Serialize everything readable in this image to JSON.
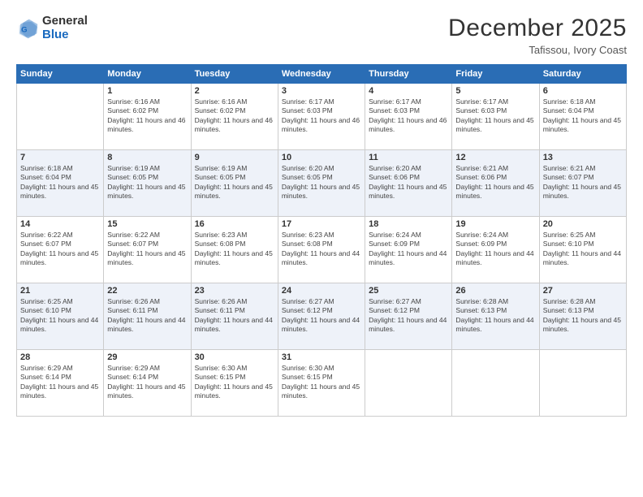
{
  "header": {
    "logo_general": "General",
    "logo_blue": "Blue",
    "month_title": "December 2025",
    "location": "Tafissou, Ivory Coast"
  },
  "calendar": {
    "headers": [
      "Sunday",
      "Monday",
      "Tuesday",
      "Wednesday",
      "Thursday",
      "Friday",
      "Saturday"
    ],
    "weeks": [
      [
        {
          "day": "",
          "detail": ""
        },
        {
          "day": "1",
          "detail": "Sunrise: 6:16 AM\nSunset: 6:02 PM\nDaylight: 11 hours and 46 minutes."
        },
        {
          "day": "2",
          "detail": "Sunrise: 6:16 AM\nSunset: 6:02 PM\nDaylight: 11 hours and 46 minutes."
        },
        {
          "day": "3",
          "detail": "Sunrise: 6:17 AM\nSunset: 6:03 PM\nDaylight: 11 hours and 46 minutes."
        },
        {
          "day": "4",
          "detail": "Sunrise: 6:17 AM\nSunset: 6:03 PM\nDaylight: 11 hours and 46 minutes."
        },
        {
          "day": "5",
          "detail": "Sunrise: 6:17 AM\nSunset: 6:03 PM\nDaylight: 11 hours and 45 minutes."
        },
        {
          "day": "6",
          "detail": "Sunrise: 6:18 AM\nSunset: 6:04 PM\nDaylight: 11 hours and 45 minutes."
        }
      ],
      [
        {
          "day": "7",
          "detail": "Sunrise: 6:18 AM\nSunset: 6:04 PM\nDaylight: 11 hours and 45 minutes."
        },
        {
          "day": "8",
          "detail": "Sunrise: 6:19 AM\nSunset: 6:05 PM\nDaylight: 11 hours and 45 minutes."
        },
        {
          "day": "9",
          "detail": "Sunrise: 6:19 AM\nSunset: 6:05 PM\nDaylight: 11 hours and 45 minutes."
        },
        {
          "day": "10",
          "detail": "Sunrise: 6:20 AM\nSunset: 6:05 PM\nDaylight: 11 hours and 45 minutes."
        },
        {
          "day": "11",
          "detail": "Sunrise: 6:20 AM\nSunset: 6:06 PM\nDaylight: 11 hours and 45 minutes."
        },
        {
          "day": "12",
          "detail": "Sunrise: 6:21 AM\nSunset: 6:06 PM\nDaylight: 11 hours and 45 minutes."
        },
        {
          "day": "13",
          "detail": "Sunrise: 6:21 AM\nSunset: 6:07 PM\nDaylight: 11 hours and 45 minutes."
        }
      ],
      [
        {
          "day": "14",
          "detail": "Sunrise: 6:22 AM\nSunset: 6:07 PM\nDaylight: 11 hours and 45 minutes."
        },
        {
          "day": "15",
          "detail": "Sunrise: 6:22 AM\nSunset: 6:07 PM\nDaylight: 11 hours and 45 minutes."
        },
        {
          "day": "16",
          "detail": "Sunrise: 6:23 AM\nSunset: 6:08 PM\nDaylight: 11 hours and 45 minutes."
        },
        {
          "day": "17",
          "detail": "Sunrise: 6:23 AM\nSunset: 6:08 PM\nDaylight: 11 hours and 44 minutes."
        },
        {
          "day": "18",
          "detail": "Sunrise: 6:24 AM\nSunset: 6:09 PM\nDaylight: 11 hours and 44 minutes."
        },
        {
          "day": "19",
          "detail": "Sunrise: 6:24 AM\nSunset: 6:09 PM\nDaylight: 11 hours and 44 minutes."
        },
        {
          "day": "20",
          "detail": "Sunrise: 6:25 AM\nSunset: 6:10 PM\nDaylight: 11 hours and 44 minutes."
        }
      ],
      [
        {
          "day": "21",
          "detail": "Sunrise: 6:25 AM\nSunset: 6:10 PM\nDaylight: 11 hours and 44 minutes."
        },
        {
          "day": "22",
          "detail": "Sunrise: 6:26 AM\nSunset: 6:11 PM\nDaylight: 11 hours and 44 minutes."
        },
        {
          "day": "23",
          "detail": "Sunrise: 6:26 AM\nSunset: 6:11 PM\nDaylight: 11 hours and 44 minutes."
        },
        {
          "day": "24",
          "detail": "Sunrise: 6:27 AM\nSunset: 6:12 PM\nDaylight: 11 hours and 44 minutes."
        },
        {
          "day": "25",
          "detail": "Sunrise: 6:27 AM\nSunset: 6:12 PM\nDaylight: 11 hours and 44 minutes."
        },
        {
          "day": "26",
          "detail": "Sunrise: 6:28 AM\nSunset: 6:13 PM\nDaylight: 11 hours and 44 minutes."
        },
        {
          "day": "27",
          "detail": "Sunrise: 6:28 AM\nSunset: 6:13 PM\nDaylight: 11 hours and 45 minutes."
        }
      ],
      [
        {
          "day": "28",
          "detail": "Sunrise: 6:29 AM\nSunset: 6:14 PM\nDaylight: 11 hours and 45 minutes."
        },
        {
          "day": "29",
          "detail": "Sunrise: 6:29 AM\nSunset: 6:14 PM\nDaylight: 11 hours and 45 minutes."
        },
        {
          "day": "30",
          "detail": "Sunrise: 6:30 AM\nSunset: 6:15 PM\nDaylight: 11 hours and 45 minutes."
        },
        {
          "day": "31",
          "detail": "Sunrise: 6:30 AM\nSunset: 6:15 PM\nDaylight: 11 hours and 45 minutes."
        },
        {
          "day": "",
          "detail": ""
        },
        {
          "day": "",
          "detail": ""
        },
        {
          "day": "",
          "detail": ""
        }
      ]
    ]
  }
}
